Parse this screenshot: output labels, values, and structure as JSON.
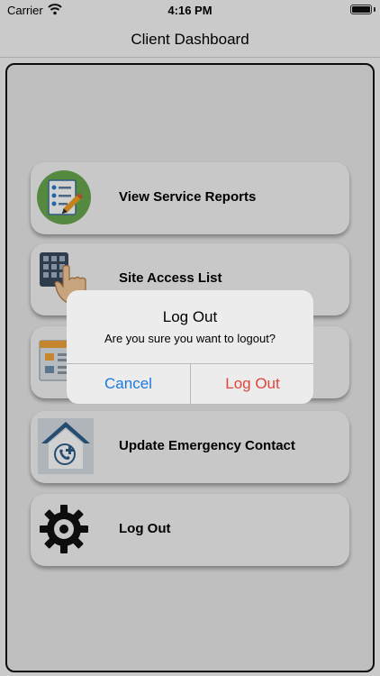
{
  "status_bar": {
    "carrier": "Carrier",
    "time": "4:16 PM",
    "wifi_icon": "wifi-icon",
    "battery_icon": "battery-icon"
  },
  "nav": {
    "title": "Client Dashboard"
  },
  "menu": [
    {
      "label": "View Service Reports",
      "icon": "service-reports-icon"
    },
    {
      "label": "Site Access List",
      "icon": "keypad-hand-icon"
    },
    {
      "label": "",
      "icon": "documents-icon"
    },
    {
      "label": "Update Emergency Contact",
      "icon": "emergency-contact-icon"
    },
    {
      "label": "Log Out",
      "icon": "gear-icon"
    }
  ],
  "alert": {
    "title": "Log Out",
    "message": "Are you sure you want to logout?",
    "cancel_label": "Cancel",
    "confirm_label": "Log Out"
  },
  "colors": {
    "accent_blue": "#1a7ae0",
    "destructive_red": "#e0443a"
  }
}
